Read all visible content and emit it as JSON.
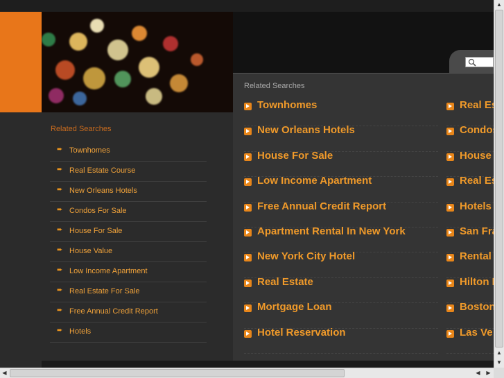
{
  "search": {
    "placeholder": ""
  },
  "sidebar": {
    "title": "Related Searches",
    "items": [
      "Townhomes",
      "Real Estate Course",
      "New Orleans Hotels",
      "Condos For Sale",
      "House For Sale",
      "House Value",
      "Low Income Apartment",
      "Real Estate For Sale",
      "Free Annual Credit Report",
      "Hotels"
    ]
  },
  "main": {
    "title": "Related Searches",
    "left_column": [
      "Townhomes",
      "New Orleans Hotels",
      "House For Sale",
      "Low Income Apartment",
      "Free Annual Credit Report",
      "Apartment Rental In New York",
      "New York City Hotel",
      "Real Estate",
      "Mortgage Loan",
      "Hotel Reservation"
    ],
    "right_column": [
      "Real Es",
      "Condos",
      "House",
      "Real Es",
      "Hotels",
      "San Fra",
      "Rental",
      "Hilton H",
      "Boston",
      "Las Ve"
    ]
  },
  "colors": {
    "accent": "#e8761a",
    "link": "#f09a2a",
    "background": "#2b2b2b"
  },
  "icons": {
    "search": "magnifier-icon",
    "list_bullet": "orange-arrow-icon",
    "sidebar_bullet": "hand-pointer-icon"
  }
}
